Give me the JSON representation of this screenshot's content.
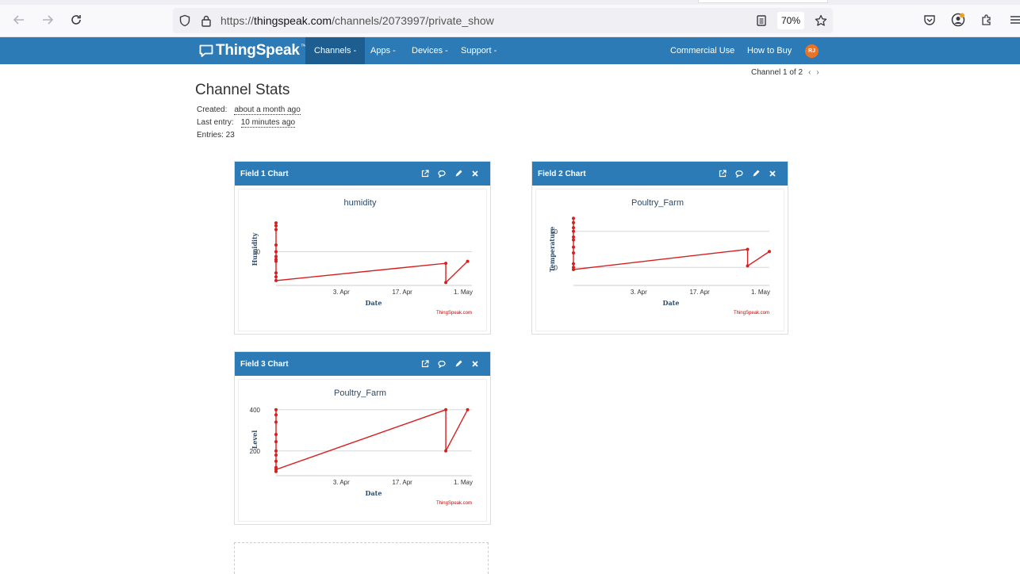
{
  "browser": {
    "url_prefix": "https://",
    "url_host": "thingspeak.com",
    "url_path": "/channels/2073997/private_show",
    "zoom": "70%"
  },
  "navbar": {
    "brand": "ThingSpeak",
    "brand_tm": "™",
    "items": [
      "Channels -",
      "Apps -",
      "Devices -",
      "Support -"
    ],
    "right_items": [
      "Commercial Use",
      "How to Buy"
    ],
    "avatar": "RJ"
  },
  "channel": {
    "pager": "Channel 1 of 2",
    "title": "Channel Stats",
    "created_label": "Created:",
    "created_value": "about a month ago",
    "last_entry_label": "Last entry:",
    "last_entry_value": "10 minutes ago",
    "entries": "Entries: 23"
  },
  "widgets": [
    {
      "title": "Field 1 Chart"
    },
    {
      "title": "Field 2 Chart"
    },
    {
      "title": "Field 3 Chart"
    }
  ],
  "chart_data": [
    {
      "type": "line",
      "title": "humidity",
      "xlabel": "Date",
      "ylabel": "Humidity",
      "x_ticks": [
        "3. Apr",
        "17. Apr",
        "1. May"
      ],
      "y_ticks": [
        50
      ],
      "ylim": [
        15,
        90
      ],
      "credit": "ThingSpeak.com",
      "color": "#d62020",
      "series": [
        {
          "x_days": [
            0,
            0,
            0,
            0,
            0,
            0,
            0,
            0,
            0,
            0,
            0,
            39,
            39,
            44
          ],
          "values": [
            80,
            77,
            73,
            57,
            50,
            45,
            42,
            40,
            28,
            24,
            20,
            38,
            18,
            40
          ]
        }
      ]
    },
    {
      "type": "line",
      "title": "Poultry_Farm",
      "xlabel": "Date",
      "ylabel": "Temperature",
      "x_ticks": [
        "3. Apr",
        "17. Apr",
        "1. May"
      ],
      "y_ticks": [
        0,
        50
      ],
      "ylim": [
        -25,
        75
      ],
      "credit": "ThingSpeak.com",
      "color": "#d62020",
      "series": [
        {
          "x_days": [
            0,
            0,
            0,
            0,
            0,
            0,
            0,
            0,
            0,
            0,
            0,
            40,
            40,
            45
          ],
          "values": [
            68,
            62,
            55,
            50,
            42,
            38,
            28,
            20,
            5,
            0,
            -3,
            25,
            2,
            22
          ]
        }
      ]
    },
    {
      "type": "line",
      "title": "Poultry_Farm",
      "xlabel": "Date",
      "ylabel": "Level",
      "x_ticks": [
        "3. Apr",
        "17. Apr",
        "1. May"
      ],
      "y_ticks": [
        200,
        400
      ],
      "ylim": [
        80,
        430
      ],
      "credit": "ThingSpeak.com",
      "color": "#d62020",
      "series": [
        {
          "x_days": [
            0,
            0,
            0,
            0,
            0,
            0,
            0,
            0,
            0,
            0,
            0,
            39,
            39,
            44
          ],
          "values": [
            400,
            375,
            340,
            280,
            245,
            200,
            180,
            150,
            120,
            100,
            110,
            400,
            200,
            400
          ]
        }
      ]
    }
  ]
}
